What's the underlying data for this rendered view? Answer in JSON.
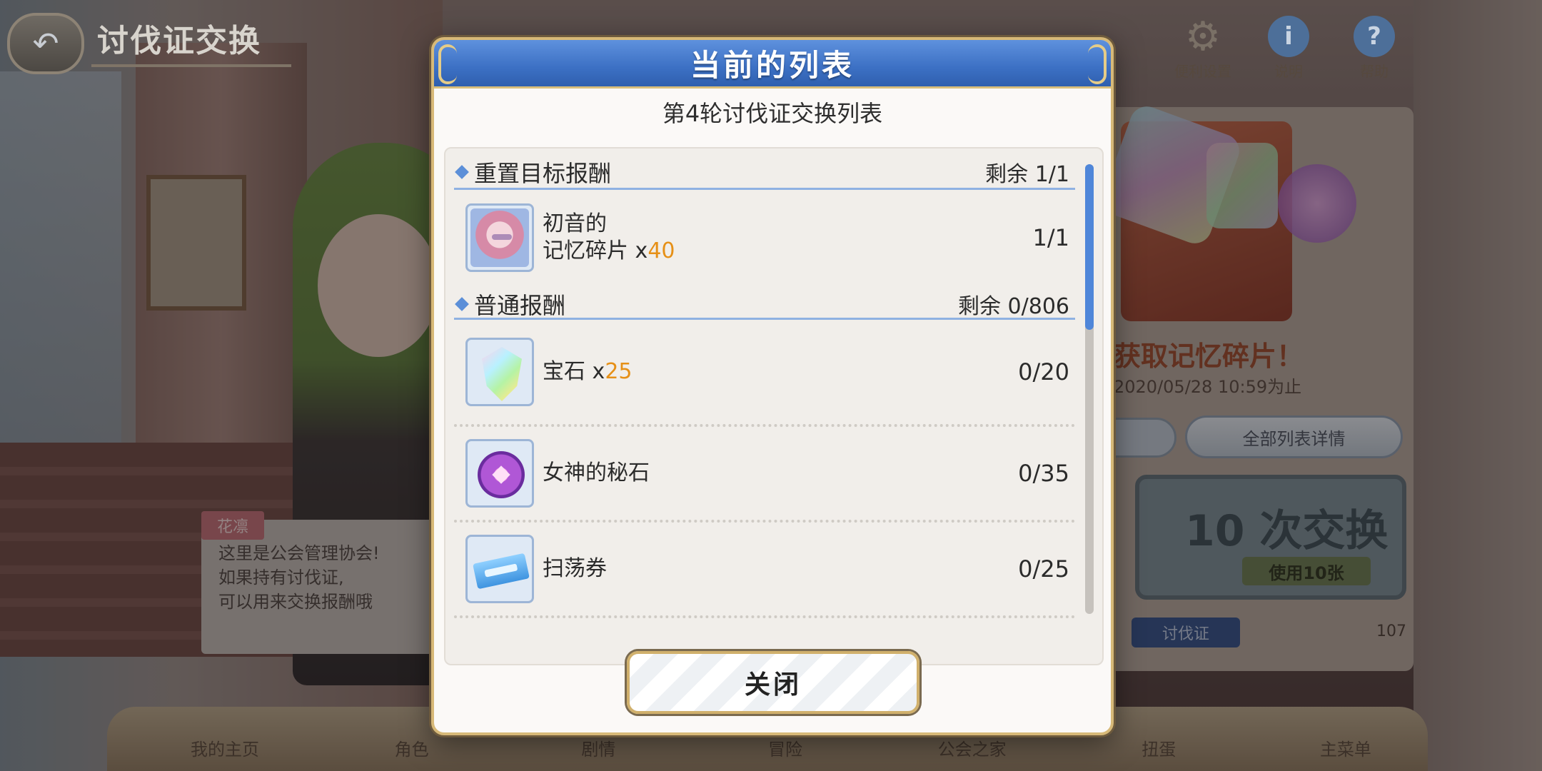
{
  "header": {
    "back_icon": "back-arrow-icon",
    "title": "讨伐证交换"
  },
  "top_icons": [
    {
      "icon": "gear-icon",
      "label": "便利设置"
    },
    {
      "icon": "info-icon",
      "label": "说明"
    },
    {
      "icon": "help-icon",
      "label": "帮助"
    }
  ],
  "background": {
    "banner_text": "获取记忆碎片！",
    "date_text": "2020/05/28 10:59为止",
    "all_list_button": "全部列表详情",
    "exchange_count": "10 次交换",
    "exchange_sub": "使用10张",
    "currency_tag": "讨伐证",
    "currency_count": "107",
    "speech_name": "花凛",
    "speech_lines": [
      "这里是公会管理协会!",
      "如果持有讨伐证,",
      "可以用来交换报酬哦"
    ]
  },
  "bottom_nav": [
    "我的主页",
    "角色",
    "剧情",
    "冒险",
    "公会之家",
    "扭蛋",
    "主菜单"
  ],
  "modal": {
    "title": "当前的列表",
    "subtitle": "第4轮讨伐证交换列表",
    "sections": [
      {
        "name": "重置目标报酬",
        "remain": "剩余 1/1",
        "items": [
          {
            "name_line1": "初音的",
            "name_line2": "记忆碎片",
            "qty": "40",
            "count": "1/1",
            "icon": "hatsune-memory-piece-icon"
          }
        ]
      },
      {
        "name": "普通报酬",
        "remain": "剩余 0/806",
        "items": [
          {
            "name": "宝石",
            "qty": "25",
            "count": "0/20",
            "icon": "jewel-icon"
          },
          {
            "name": "女神的秘石",
            "qty": "",
            "count": "0/35",
            "icon": "goddess-stone-icon"
          },
          {
            "name": "扫荡券",
            "qty": "",
            "count": "0/25",
            "icon": "skip-ticket-icon"
          }
        ]
      }
    ],
    "close_label": "关闭"
  },
  "colors": {
    "modal_header": "#3c70c4",
    "quantity_accent": "#e69017",
    "scroll_thumb": "#4f86d9",
    "section_underline": "#8fb1e2"
  }
}
